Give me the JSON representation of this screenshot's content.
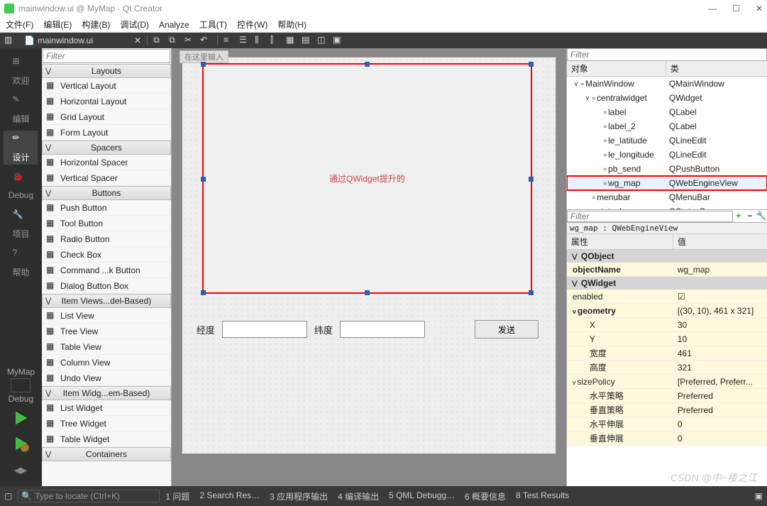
{
  "window": {
    "title": "mainwindow.ui @ MyMap - Qt Creator"
  },
  "menubar": [
    "文件(F)",
    "编辑(E)",
    "构建(B)",
    "调试(D)",
    "Analyze",
    "工具(T)",
    "控件(W)",
    "帮助(H)"
  ],
  "open_file_tab": "mainwindow.ui",
  "leftbar": {
    "modes": [
      {
        "label": "欢迎"
      },
      {
        "label": "编辑"
      },
      {
        "label": "设计",
        "active": true
      },
      {
        "label": "Debug"
      },
      {
        "label": "项目"
      },
      {
        "label": "帮助"
      }
    ],
    "project": {
      "name": "MyMap",
      "debug": "Debug"
    }
  },
  "widgetbox": {
    "filter_placeholder": "Filter",
    "groups": [
      {
        "name": "Layouts",
        "items": [
          "Vertical Layout",
          "Horizontal Layout",
          "Grid Layout",
          "Form Layout"
        ]
      },
      {
        "name": "Spacers",
        "items": [
          "Horizontal Spacer",
          "Vertical Spacer"
        ]
      },
      {
        "name": "Buttons",
        "items": [
          "Push Button",
          "Tool Button",
          "Radio Button",
          "Check Box",
          "Command ...k Button",
          "Dialog Button Box"
        ]
      },
      {
        "name": "Item Views...del-Based)",
        "items": [
          "List View",
          "Tree View",
          "Table View",
          "Column View",
          "Undo View"
        ]
      },
      {
        "name": "Item Widg...em-Based)",
        "items": [
          "List Widget",
          "Tree Widget",
          "Table Widget"
        ]
      },
      {
        "name": "Containers",
        "items": []
      }
    ]
  },
  "form": {
    "prompt": "在这里输入",
    "annotation": "通过QWidget提升的",
    "labels": {
      "lng": "经度",
      "lat": "纬度",
      "send": "发送"
    }
  },
  "object_inspector": {
    "filter_placeholder": "Filter",
    "headers": [
      "对象",
      "类"
    ],
    "rows": [
      {
        "depth": 0,
        "name": "MainWindow",
        "cls": "QMainWindow",
        "exp": "v"
      },
      {
        "depth": 1,
        "name": "centralwidget",
        "cls": "QWidget",
        "exp": "v"
      },
      {
        "depth": 2,
        "name": "label",
        "cls": "QLabel"
      },
      {
        "depth": 2,
        "name": "label_2",
        "cls": "QLabel"
      },
      {
        "depth": 2,
        "name": "le_latitude",
        "cls": "QLineEdit"
      },
      {
        "depth": 2,
        "name": "le_longitude",
        "cls": "QLineEdit"
      },
      {
        "depth": 2,
        "name": "pb_send",
        "cls": "QPushButton"
      },
      {
        "depth": 2,
        "name": "wg_map",
        "cls": "QWebEngineView",
        "selected": true
      },
      {
        "depth": 1,
        "name": "menubar",
        "cls": "QMenuBar"
      },
      {
        "depth": 1,
        "name": "statusbar",
        "cls": "QStatusBar"
      }
    ]
  },
  "property_editor": {
    "filter_placeholder": "Filter",
    "context": "wg_map : QWebEngineView",
    "headers": [
      "属性",
      "值"
    ],
    "groups": [
      {
        "name": "QObject",
        "rows": [
          {
            "k": "objectName",
            "v": "wg_map",
            "bold": true
          }
        ]
      },
      {
        "name": "QWidget",
        "rows": [
          {
            "k": "enabled",
            "v": "☑"
          },
          {
            "k": "geometry",
            "v": "[(30, 10), 461 x 321]",
            "bold": true,
            "exp": "v",
            "children": [
              {
                "k": "X",
                "v": "30"
              },
              {
                "k": "Y",
                "v": "10"
              },
              {
                "k": "宽度",
                "v": "461"
              },
              {
                "k": "高度",
                "v": "321"
              }
            ]
          },
          {
            "k": "sizePolicy",
            "v": "[Preferred, Preferr...",
            "exp": "v",
            "children": [
              {
                "k": "水平策略",
                "v": "Preferred"
              },
              {
                "k": "垂直策略",
                "v": "Preferred"
              },
              {
                "k": "水平伸展",
                "v": "0"
              },
              {
                "k": "垂直伸展",
                "v": "0"
              }
            ]
          }
        ]
      }
    ]
  },
  "statusbar": {
    "search_placeholder": "Type to locate (Ctrl+K)",
    "items": [
      "1 问题",
      "2 Search Res…",
      "3 应用程序输出",
      "4 编译输出",
      "5 QML Debugg…",
      "6 概要信息",
      "8 Test Results"
    ]
  },
  "watermark": "CSDN @中~楼之江"
}
